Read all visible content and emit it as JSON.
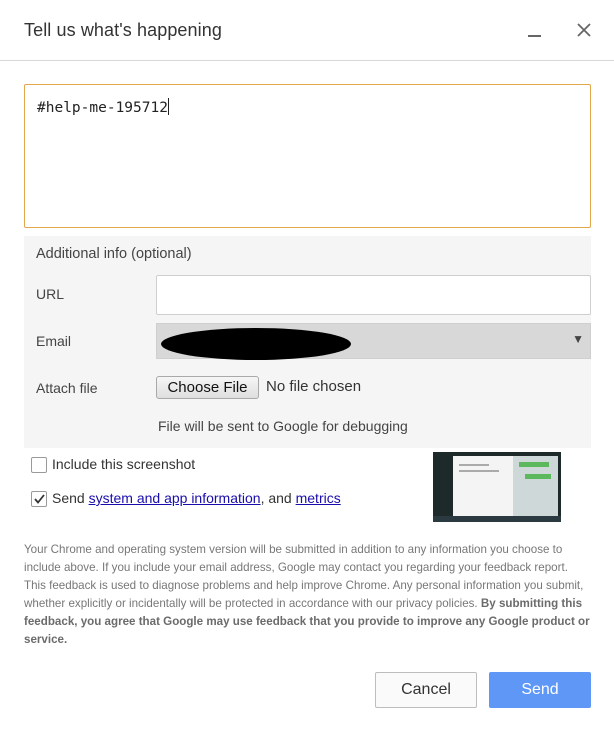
{
  "dialog": {
    "title": "Tell us what's happening",
    "minimize_icon": "minimize-icon",
    "close_icon": "close-icon"
  },
  "description": {
    "value": "#help-me-195712"
  },
  "additional_info": {
    "heading": "Additional info (optional)",
    "url_label": "URL",
    "url_value": "",
    "email_label": "Email",
    "email_value": "",
    "attach_label": "Attach file",
    "choose_file_label": "Choose File",
    "no_file_text": "No file chosen",
    "debug_note": "File will be sent to Google for debugging"
  },
  "options": {
    "include_screenshot_label": "Include this screenshot",
    "include_screenshot_checked": false,
    "send_info_prefix": "Send ",
    "send_info_link1": "system and app information",
    "send_info_mid": ", and ",
    "send_info_link2": "metrics",
    "send_info_checked": true
  },
  "disclaimer": {
    "text": "Your Chrome and operating system version will be submitted in addition to any information you choose to include above. If you include your email address, Google may contact you regarding your feedback report. This feedback is used to diagnose problems and help improve Chrome. Any personal information you submit, whether explicitly or incidentally will be protected in accordance with our privacy policies.",
    "bold_text": "By submitting this feedback, you agree that Google may use feedback that you provide to improve any Google product or service."
  },
  "actions": {
    "cancel_label": "Cancel",
    "send_label": "Send"
  },
  "colors": {
    "focus_border": "#e2a64b",
    "primary_button": "#5e97f6",
    "link": "#1a0dab"
  }
}
